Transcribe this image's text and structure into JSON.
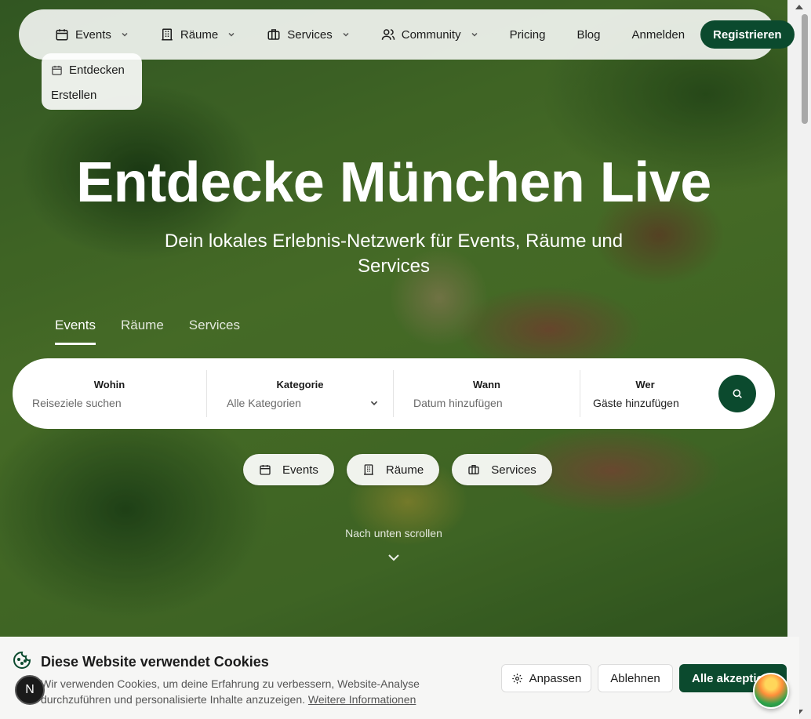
{
  "nav": {
    "items": [
      {
        "label": "Events",
        "icon": "calendar-icon"
      },
      {
        "label": "Räume",
        "icon": "building-icon"
      },
      {
        "label": "Services",
        "icon": "briefcase-icon"
      },
      {
        "label": "Community",
        "icon": "users-icon"
      }
    ],
    "pricing": "Pricing",
    "blog": "Blog",
    "login": "Anmelden",
    "register": "Registrieren"
  },
  "dropdown": {
    "discover": "Entdecken",
    "create": "Erstellen"
  },
  "hero": {
    "title": "Entdecke München Live",
    "subtitle": "Dein lokales Erlebnis-Netzwerk für Events, Räume und Services"
  },
  "tabs": [
    "Events",
    "Räume",
    "Services"
  ],
  "search": {
    "where_label": "Wohin",
    "where_placeholder": "Reiseziele suchen",
    "category_label": "Kategorie",
    "category_value": "Alle Kategorien",
    "when_label": "Wann",
    "when_placeholder": "Datum hinzufügen",
    "who_label": "Wer",
    "who_value": "Gäste hinzufügen"
  },
  "pills": [
    "Events",
    "Räume",
    "Services"
  ],
  "scroll_hint": "Nach unten scrollen",
  "cookie": {
    "title": "Diese Website verwendet Cookies",
    "text": "Wir verwenden Cookies, um deine Erfahrung zu verbessern, Website-Analyse durchzuführen und personalisierte Inhalte anzuzeigen.",
    "more": "Weitere Informationen",
    "customize": "Anpassen",
    "decline": "Ablehnen",
    "accept": "Alle akzeptie"
  },
  "badge_letter": "N",
  "colors": {
    "accent": "#0b4a2e"
  }
}
